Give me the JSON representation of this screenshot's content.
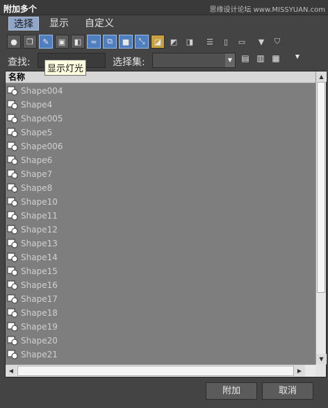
{
  "window": {
    "title": "附加多个",
    "watermark": "思缘设计论坛 www.MISSYUAN.com"
  },
  "menu": [
    {
      "label": "选择",
      "active": true
    },
    {
      "label": "显示",
      "active": false
    },
    {
      "label": "自定义",
      "active": false
    }
  ],
  "toolbar": {
    "icons": [
      "sphere-icon",
      "copy-icon",
      "light-icon",
      "camera-icon",
      "helper-icon",
      "space-warp-icon",
      "group-icon",
      "xref-icon",
      "bone-icon",
      "select-all-icon",
      "select-none-icon",
      "invert-icon",
      "list-a-icon",
      "list-b-icon",
      "list-c-icon",
      "filter-icon",
      "filter-list-icon"
    ]
  },
  "search": {
    "find_label": "查找:",
    "find_value": "",
    "set_label": "选择集:",
    "set_value": ""
  },
  "tooltip": "显示灯光",
  "list": {
    "header": "名称",
    "items": [
      "Shape004",
      "Shape4",
      "Shape005",
      "Shape5",
      "Shape006",
      "Shape6",
      "Shape7",
      "Shape8",
      "Shape10",
      "Shape11",
      "Shape12",
      "Shape13",
      "Shape14",
      "Shape15",
      "Shape16",
      "Shape17",
      "Shape18",
      "Shape19",
      "Shape20",
      "Shape21"
    ]
  },
  "footer": {
    "attach_label": "附加",
    "cancel_label": "取消"
  },
  "colors": {
    "accent": "#4f7fbf",
    "list_bg": "#7e7e7e",
    "tooltip_bg": "#ffffe1"
  }
}
